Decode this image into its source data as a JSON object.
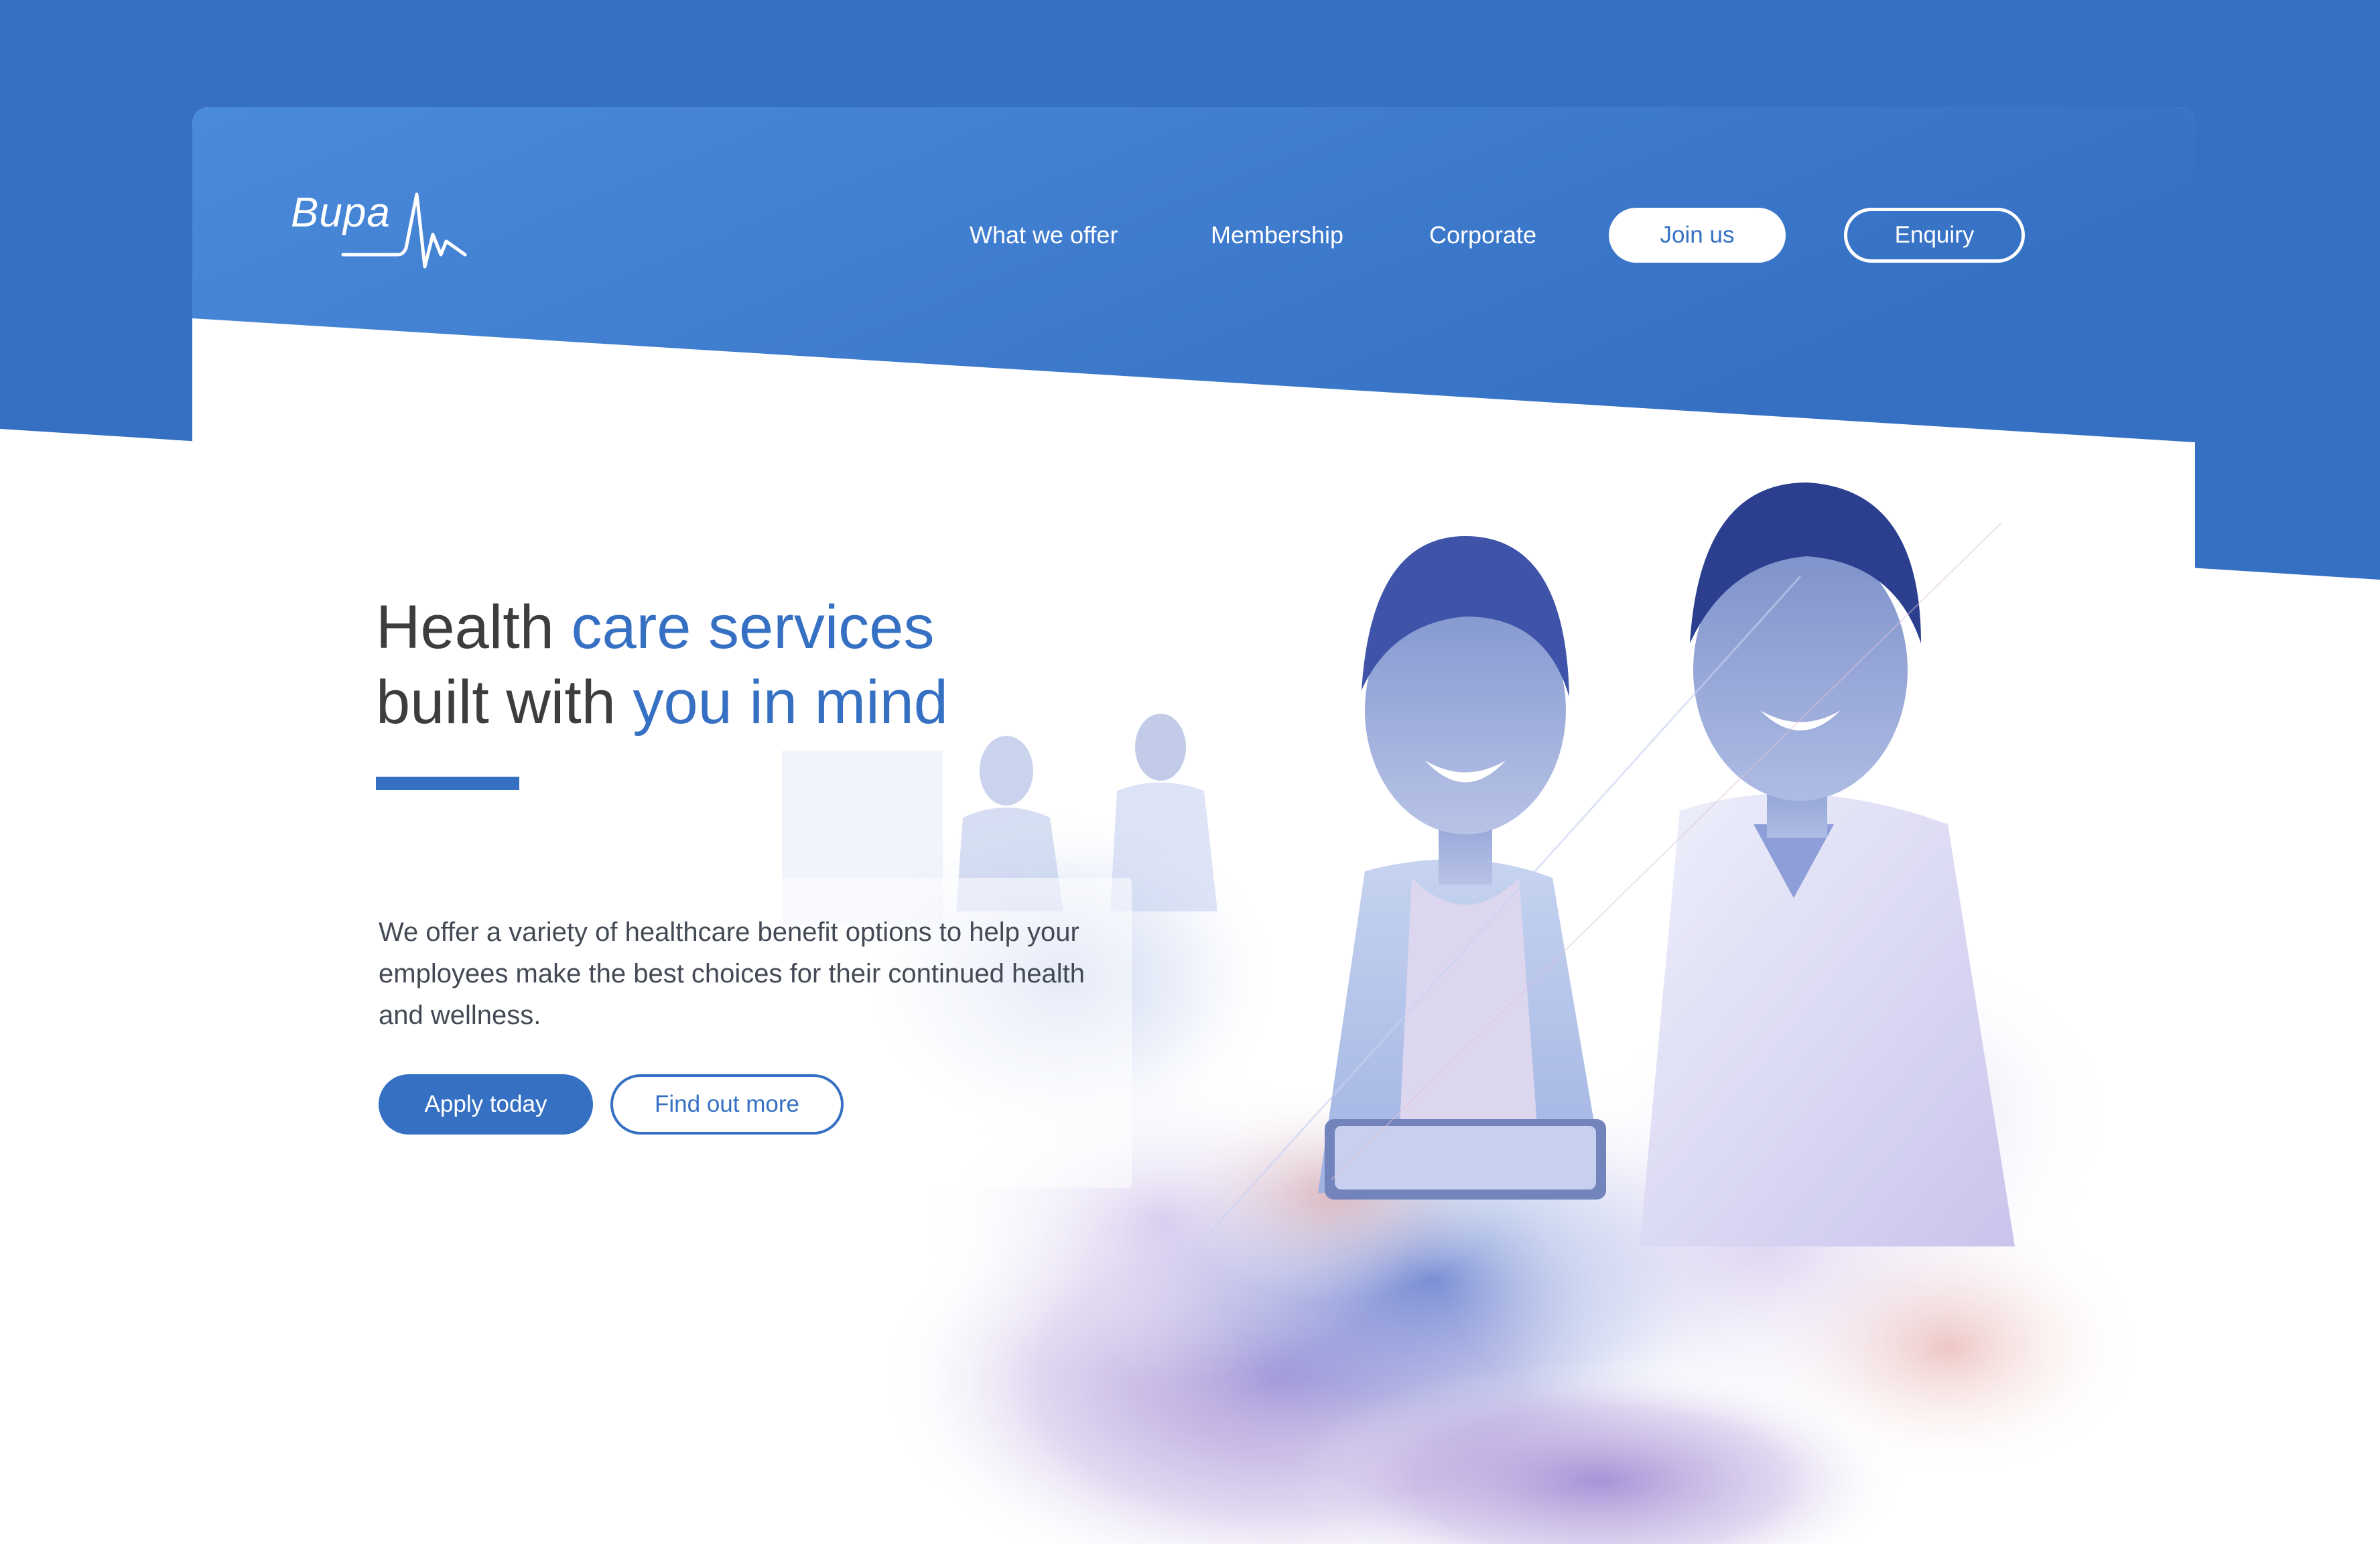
{
  "brand": {
    "name": "Bupa",
    "primary_color": "#3570c3",
    "dark_text_color": "#3d3d3d"
  },
  "nav": {
    "items": [
      {
        "label": "What we offer"
      },
      {
        "label": "Membership"
      },
      {
        "label": "Corporate"
      }
    ],
    "join_label": "Join us",
    "enquiry_label": "Enquiry"
  },
  "hero": {
    "title_line1_dark": "Health ",
    "title_line1_accent": "care services",
    "title_line2_dark": "built with ",
    "title_line2_accent": "you in mind",
    "description": "We offer a variety of healthcare benefit options to help your employees make the best choices for their continued health and wellness.",
    "primary_cta": "Apply today",
    "secondary_cta": "Find out more"
  }
}
